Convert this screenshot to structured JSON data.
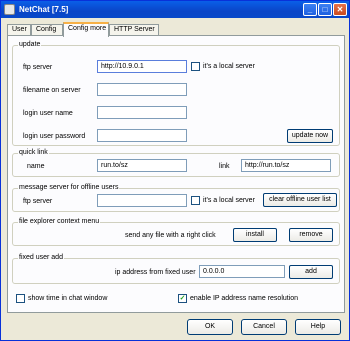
{
  "window": {
    "title": "NetChat [7.5]"
  },
  "titlebar_buttons": {
    "minimize": "_",
    "maximize": "□",
    "close": "✕"
  },
  "tabs": [
    "User",
    "Config",
    "Config more",
    "HTTP Server"
  ],
  "update": {
    "group_label": "update",
    "ftp_server_label": "ftp server",
    "ftp_server_value": "http://10.9.0.1",
    "local_server_label": "it's a local server",
    "filename_label": "filename on server",
    "filename_value": "",
    "login_user_label": "login user name",
    "login_user_value": "",
    "login_password_label": "login user password",
    "login_password_value": "",
    "update_now_button": "update now"
  },
  "quick_link": {
    "group_label": "quick link",
    "name_label": "name",
    "name_value": "run.to/sz",
    "link_label": "link",
    "link_value": "http://run.to/sz"
  },
  "offline": {
    "group_label": "message server for offline users",
    "ftp_server_label": "ftp server",
    "ftp_server_value": "",
    "local_server_label": "it's a local server",
    "clear_button": "clear offline user list"
  },
  "context_menu": {
    "group_label": "file explorer context menu",
    "description": "send any file with a right click",
    "install_button": "install",
    "remove_button": "remove"
  },
  "fixed_user": {
    "group_label": "fixed user add",
    "ip_label": "ip address from fixed user",
    "ip_value": "0.0.0.0",
    "add_button": "add"
  },
  "options": {
    "show_time_label": "show time in chat window",
    "show_time_checked": false,
    "ip_resolution_label": "enable IP address name resolution",
    "ip_resolution_checked": true
  },
  "footer": {
    "ok": "OK",
    "cancel": "Cancel",
    "help": "Help"
  }
}
